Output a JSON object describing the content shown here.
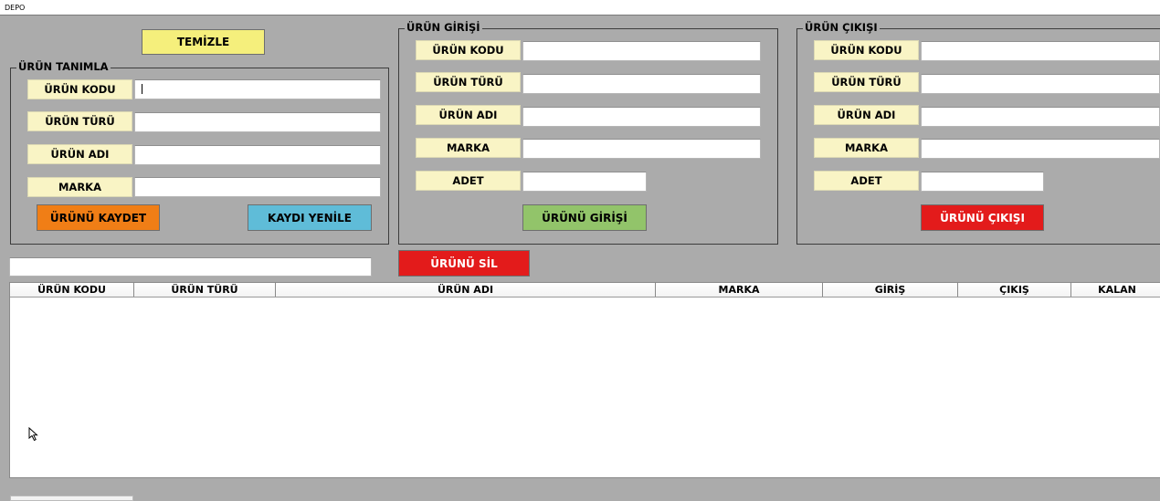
{
  "window": {
    "title": "DEPO"
  },
  "clear_button": "TEMİZLE",
  "define_panel": {
    "title": "ÜRÜN TANIMLA",
    "labels": {
      "code": "ÜRÜN KODU",
      "type": "ÜRÜN TÜRÜ",
      "name": "ÜRÜN ADI",
      "brand": "MARKA"
    },
    "values": {
      "code": "",
      "type": "",
      "name": "",
      "brand": ""
    },
    "save_button": "ÜRÜNÜ KAYDET",
    "refresh_button": "KAYDI YENİLE"
  },
  "entry_panel": {
    "title": "ÜRÜN GİRİŞİ",
    "labels": {
      "code": "ÜRÜN KODU",
      "type": "ÜRÜN TÜRÜ",
      "name": "ÜRÜN ADI",
      "brand": "MARKA",
      "qty": "ADET"
    },
    "values": {
      "code": "",
      "type": "",
      "name": "",
      "brand": "",
      "qty": ""
    },
    "submit_button": "ÜRÜNÜ GİRİŞİ"
  },
  "exit_panel": {
    "title": "ÜRÜN ÇIKIŞI",
    "labels": {
      "code": "ÜRÜN KODU",
      "type": "ÜRÜN TÜRÜ",
      "name": "ÜRÜN ADI",
      "brand": "MARKA",
      "qty": "ADET"
    },
    "values": {
      "code": "",
      "type": "",
      "name": "",
      "brand": "",
      "qty": ""
    },
    "submit_button": "ÜRÜNÜ ÇIKIŞI"
  },
  "search": {
    "value": ""
  },
  "delete_button": "ÜRÜNÜ SİL",
  "table": {
    "columns": [
      "ÜRÜN KODU",
      "ÜRÜN TÜRÜ",
      "ÜRÜN ADI",
      "MARKA",
      "GİRİŞ",
      "ÇIKIŞ",
      "KALAN"
    ],
    "rows": []
  },
  "colors": {
    "background": "#ababab",
    "label_bg": "#f9f4c5",
    "clear_button": "#f5ef7c",
    "save_button": "#f07e16",
    "refresh_button": "#5fbcd8",
    "entry_button": "#92c46a",
    "exit_button": "#e31b1b",
    "delete_button": "#e31b1b"
  }
}
